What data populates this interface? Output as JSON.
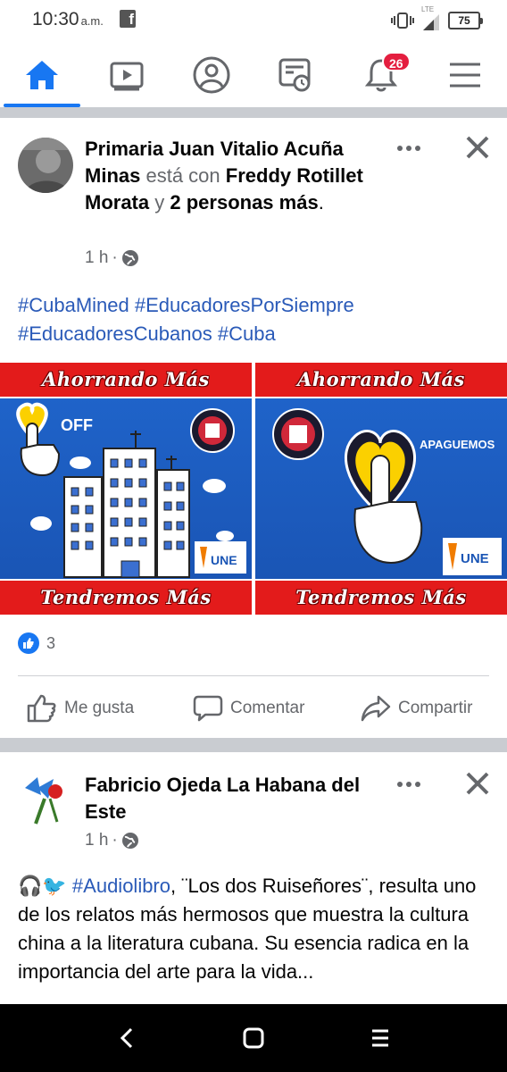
{
  "status": {
    "time": "10:30",
    "ampm": "a.m.",
    "fb_glyph": "f",
    "network": "LTE",
    "battery": "75"
  },
  "nav": {
    "items": [
      "home-icon",
      "watch-icon",
      "profile-icon",
      "news-icon",
      "notifications-icon",
      "menu-icon"
    ],
    "notifications_badge": "26",
    "accent": "#1877f2"
  },
  "post1": {
    "author": "Primaria Juan Vitalio Acuña Minas",
    "with_text": "está con",
    "tagged": "Freddy Rotillet Morata",
    "and_text": "y",
    "others": "2 personas más",
    "period": ".",
    "time": "1 h",
    "hashtags": [
      "#CubaMined",
      "#EducadoresPorSiempre",
      "#EducadoresCubanos",
      "#Cuba"
    ],
    "image": {
      "banner_top": "Ahorrando Más",
      "banner_bottom": "Tendremos Más",
      "left_label": "OFF",
      "right_label": "APAGUEMOS",
      "logo_text": "UNE"
    },
    "like_count": "3",
    "actions": {
      "like": "Me gusta",
      "comment": "Comentar",
      "share": "Compartir"
    }
  },
  "post2": {
    "author": "Fabricio Ojeda La Habana del Este",
    "time": "1 h",
    "text_emojis": "🎧🐦",
    "hashtag": "#Audiolibro",
    "text_line1": ", ¨Los dos Ruiseñores¨,",
    "text_rest": "resulta uno de los relatos más hermosos que muestra la cultura china a la literatura cubana. Su esencia radica en la importancia del arte para la vida..."
  }
}
